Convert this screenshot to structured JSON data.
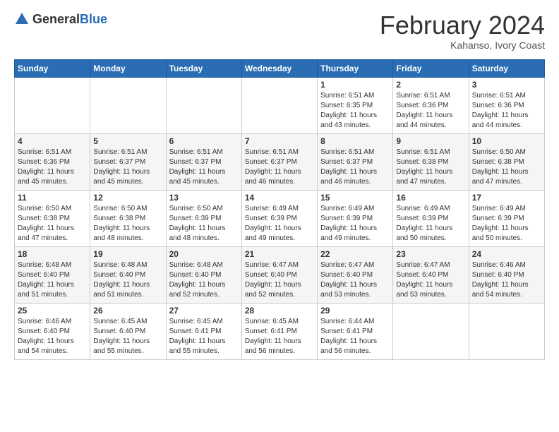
{
  "header": {
    "logo": {
      "general": "General",
      "blue": "Blue"
    },
    "title": "February 2024",
    "subtitle": "Kahanso, Ivory Coast"
  },
  "calendar": {
    "days_of_week": [
      "Sunday",
      "Monday",
      "Tuesday",
      "Wednesday",
      "Thursday",
      "Friday",
      "Saturday"
    ],
    "weeks": [
      {
        "days": [
          {
            "number": "",
            "info": ""
          },
          {
            "number": "",
            "info": ""
          },
          {
            "number": "",
            "info": ""
          },
          {
            "number": "",
            "info": ""
          },
          {
            "number": "1",
            "info": "Sunrise: 6:51 AM\nSunset: 6:35 PM\nDaylight: 11 hours\nand 43 minutes."
          },
          {
            "number": "2",
            "info": "Sunrise: 6:51 AM\nSunset: 6:36 PM\nDaylight: 11 hours\nand 44 minutes."
          },
          {
            "number": "3",
            "info": "Sunrise: 6:51 AM\nSunset: 6:36 PM\nDaylight: 11 hours\nand 44 minutes."
          }
        ]
      },
      {
        "days": [
          {
            "number": "4",
            "info": "Sunrise: 6:51 AM\nSunset: 6:36 PM\nDaylight: 11 hours\nand 45 minutes."
          },
          {
            "number": "5",
            "info": "Sunrise: 6:51 AM\nSunset: 6:37 PM\nDaylight: 11 hours\nand 45 minutes."
          },
          {
            "number": "6",
            "info": "Sunrise: 6:51 AM\nSunset: 6:37 PM\nDaylight: 11 hours\nand 45 minutes."
          },
          {
            "number": "7",
            "info": "Sunrise: 6:51 AM\nSunset: 6:37 PM\nDaylight: 11 hours\nand 46 minutes."
          },
          {
            "number": "8",
            "info": "Sunrise: 6:51 AM\nSunset: 6:37 PM\nDaylight: 11 hours\nand 46 minutes."
          },
          {
            "number": "9",
            "info": "Sunrise: 6:51 AM\nSunset: 6:38 PM\nDaylight: 11 hours\nand 47 minutes."
          },
          {
            "number": "10",
            "info": "Sunrise: 6:50 AM\nSunset: 6:38 PM\nDaylight: 11 hours\nand 47 minutes."
          }
        ]
      },
      {
        "days": [
          {
            "number": "11",
            "info": "Sunrise: 6:50 AM\nSunset: 6:38 PM\nDaylight: 11 hours\nand 47 minutes."
          },
          {
            "number": "12",
            "info": "Sunrise: 6:50 AM\nSunset: 6:38 PM\nDaylight: 11 hours\nand 48 minutes."
          },
          {
            "number": "13",
            "info": "Sunrise: 6:50 AM\nSunset: 6:39 PM\nDaylight: 11 hours\nand 48 minutes."
          },
          {
            "number": "14",
            "info": "Sunrise: 6:49 AM\nSunset: 6:39 PM\nDaylight: 11 hours\nand 49 minutes."
          },
          {
            "number": "15",
            "info": "Sunrise: 6:49 AM\nSunset: 6:39 PM\nDaylight: 11 hours\nand 49 minutes."
          },
          {
            "number": "16",
            "info": "Sunrise: 6:49 AM\nSunset: 6:39 PM\nDaylight: 11 hours\nand 50 minutes."
          },
          {
            "number": "17",
            "info": "Sunrise: 6:49 AM\nSunset: 6:39 PM\nDaylight: 11 hours\nand 50 minutes."
          }
        ]
      },
      {
        "days": [
          {
            "number": "18",
            "info": "Sunrise: 6:48 AM\nSunset: 6:40 PM\nDaylight: 11 hours\nand 51 minutes."
          },
          {
            "number": "19",
            "info": "Sunrise: 6:48 AM\nSunset: 6:40 PM\nDaylight: 11 hours\nand 51 minutes."
          },
          {
            "number": "20",
            "info": "Sunrise: 6:48 AM\nSunset: 6:40 PM\nDaylight: 11 hours\nand 52 minutes."
          },
          {
            "number": "21",
            "info": "Sunrise: 6:47 AM\nSunset: 6:40 PM\nDaylight: 11 hours\nand 52 minutes."
          },
          {
            "number": "22",
            "info": "Sunrise: 6:47 AM\nSunset: 6:40 PM\nDaylight: 11 hours\nand 53 minutes."
          },
          {
            "number": "23",
            "info": "Sunrise: 6:47 AM\nSunset: 6:40 PM\nDaylight: 11 hours\nand 53 minutes."
          },
          {
            "number": "24",
            "info": "Sunrise: 6:46 AM\nSunset: 6:40 PM\nDaylight: 11 hours\nand 54 minutes."
          }
        ]
      },
      {
        "days": [
          {
            "number": "25",
            "info": "Sunrise: 6:46 AM\nSunset: 6:40 PM\nDaylight: 11 hours\nand 54 minutes."
          },
          {
            "number": "26",
            "info": "Sunrise: 6:45 AM\nSunset: 6:40 PM\nDaylight: 11 hours\nand 55 minutes."
          },
          {
            "number": "27",
            "info": "Sunrise: 6:45 AM\nSunset: 6:41 PM\nDaylight: 11 hours\nand 55 minutes."
          },
          {
            "number": "28",
            "info": "Sunrise: 6:45 AM\nSunset: 6:41 PM\nDaylight: 11 hours\nand 56 minutes."
          },
          {
            "number": "29",
            "info": "Sunrise: 6:44 AM\nSunset: 6:41 PM\nDaylight: 11 hours\nand 56 minutes."
          },
          {
            "number": "",
            "info": ""
          },
          {
            "number": "",
            "info": ""
          }
        ]
      }
    ]
  }
}
